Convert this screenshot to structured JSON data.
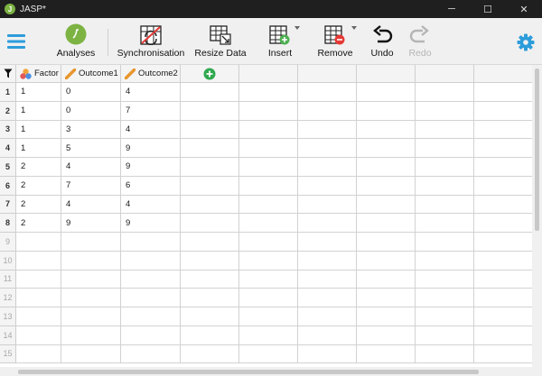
{
  "window": {
    "title": "JASP*",
    "logo_letter": "J",
    "minimize": "─",
    "maximize": "☐",
    "close": "✕"
  },
  "toolbar": {
    "menu_icon": "hamburger-menu-icon",
    "analyses": "Analyses",
    "synchronisation": "Synchronisation",
    "resize_data": "Resize Data",
    "insert": "Insert",
    "remove": "Remove",
    "undo": "Undo",
    "redo": "Redo",
    "settings_icon": "gear-icon",
    "accent_color": "#2d9cdb"
  },
  "grid": {
    "filter_icon": "filter-icon",
    "columns": [
      {
        "name": "Factor",
        "type_icon": "nominal-icon"
      },
      {
        "name": "Outcome1",
        "type_icon": "scale-icon"
      },
      {
        "name": "Outcome2",
        "type_icon": "scale-icon"
      }
    ],
    "add_column_icon": "add-column-icon",
    "row_numbers": [
      "1",
      "2",
      "3",
      "4",
      "5",
      "6",
      "7",
      "8",
      "9",
      "10",
      "11",
      "12",
      "13",
      "14",
      "15"
    ],
    "rows": [
      [
        "1",
        "0",
        "4"
      ],
      [
        "1",
        "0",
        "7"
      ],
      [
        "1",
        "3",
        "4"
      ],
      [
        "1",
        "5",
        "9"
      ],
      [
        "2",
        "4",
        "9"
      ],
      [
        "2",
        "7",
        "6"
      ],
      [
        "2",
        "4",
        "4"
      ],
      [
        "2",
        "9",
        "9"
      ]
    ]
  }
}
